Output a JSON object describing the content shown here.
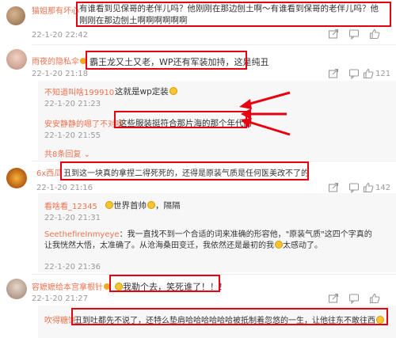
{
  "comments": [
    {
      "user": "猫姐那有坏心",
      "text": "有谁看到见保哥的老伴儿吗？他刚刚在那边刨土啊～有谁看到保哥的老伴儿吗？他刚刚在那边刨土啊啊啊啊啊啊",
      "time": "22-1-20 22:42",
      "likes": "",
      "replies": []
    },
    {
      "user": "雨夜的隐私伞",
      "text": "霸王龙又土又老，WP还有军装加持，这是纯丑",
      "time": "22-1-20 21:18",
      "likes": "121",
      "replies": [
        {
          "user": "不知道叫啥199910",
          "text": "这就是wp定装",
          "time": "22-1-20 21:23"
        },
        {
          "user": "安安静静的嗯了不对嗯",
          "text": "这些服装挺符合那片海的那个年代的",
          "time": "22-1-20 21:55"
        }
      ],
      "more": "共8条回复"
    },
    {
      "user": "6x西瓜",
      "text": "丑到这一块真的拿捏二得死死的，还得是原装气质是任何医美改不了的",
      "time": "22-1-20 21:16",
      "likes": "142",
      "replies": [
        {
          "user": "看啥看_12345",
          "text": "世界首帅",
          "text2": "，隔隔",
          "time": "22-1-20 21:31"
        },
        {
          "user": "SeethefireInmyeye",
          "text": "我一直找不到一个合适的词来准确的形容他，\"原装气质\"这四个字真的让我恍然大悟，太准确了。从沧海桑田变迁，我依然还是最初的我",
          "text2": "太感动了。",
          "time": "22-1-20 21:36"
        }
      ]
    },
    {
      "user": "容嬷嬷给本宫拿根针",
      "text": "我勒个去，笑死谁了！！！",
      "time": "22-1-20 21:27",
      "likes": "",
      "replies": [
        {
          "user": "吹得糖饼",
          "text": "丑到吐都先不说了，还特么垫肩哈哈哈哈哈哈被抵制着忽悠的一生，让他往东不敢往西",
          "time": ""
        }
      ]
    }
  ]
}
